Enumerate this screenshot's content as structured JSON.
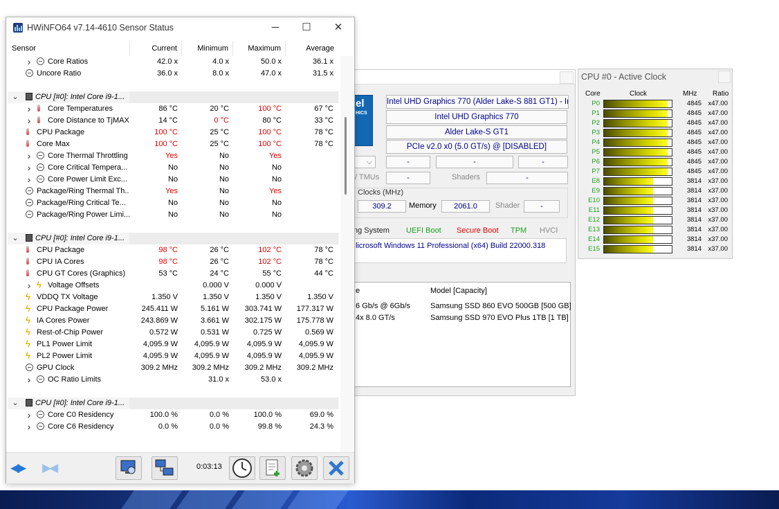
{
  "sensor_window": {
    "title": "HWiNFO64 v7.14-4610 Sensor Status",
    "columns": [
      "Sensor",
      "Current",
      "Minimum",
      "Maximum",
      "Average"
    ],
    "rows": [
      {
        "type": "item",
        "indent": 2,
        "chev": true,
        "icon": "ratio",
        "name": "Core Ratios",
        "cur": "42.0 x",
        "min": "4.0 x",
        "max": "50.0 x",
        "avg": "36.1 x"
      },
      {
        "type": "item",
        "indent": 1,
        "icon": "ratio",
        "name": "Uncore Ratio",
        "cur": "36.0 x",
        "min": "8.0 x",
        "max": "47.0 x",
        "avg": "31.5 x"
      },
      {
        "type": "blank"
      },
      {
        "type": "group",
        "name": "CPU [#0]: Intel Core i9-1..."
      },
      {
        "type": "item",
        "indent": 2,
        "chev": true,
        "icon": "temp",
        "name": "Core Temperatures",
        "cur": "86 °C",
        "min": "20 °C",
        "max": "100 °C",
        "avg": "67 °C",
        "red": [
          "max"
        ]
      },
      {
        "type": "item",
        "indent": 2,
        "chev": true,
        "icon": "temp",
        "name": "Core Distance to TjMAX",
        "cur": "14 °C",
        "min": "0 °C",
        "max": "80 °C",
        "avg": "33 °C",
        "red": [
          "min"
        ]
      },
      {
        "type": "item",
        "indent": 1,
        "icon": "temp",
        "name": "CPU Package",
        "cur": "100 °C",
        "min": "25 °C",
        "max": "100 °C",
        "avg": "78 °C",
        "red": [
          "cur",
          "max"
        ]
      },
      {
        "type": "item",
        "indent": 1,
        "icon": "temp",
        "name": "Core Max",
        "cur": "100 °C",
        "min": "25 °C",
        "max": "100 °C",
        "avg": "78 °C",
        "red": [
          "cur",
          "max"
        ]
      },
      {
        "type": "item",
        "indent": 2,
        "chev": true,
        "icon": "ratio",
        "name": "Core Thermal Throttling",
        "cur": "Yes",
        "min": "No",
        "max": "Yes",
        "avg": "",
        "red": [
          "cur",
          "max"
        ]
      },
      {
        "type": "item",
        "indent": 2,
        "chev": true,
        "icon": "ratio",
        "name": "Core Critical Tempera...",
        "cur": "No",
        "min": "No",
        "max": "No",
        "avg": ""
      },
      {
        "type": "item",
        "indent": 2,
        "chev": true,
        "icon": "ratio",
        "name": "Core Power Limit Exc...",
        "cur": "No",
        "min": "No",
        "max": "No",
        "avg": ""
      },
      {
        "type": "item",
        "indent": 1,
        "icon": "ratio",
        "name": "Package/Ring Thermal Th...",
        "cur": "Yes",
        "min": "No",
        "max": "Yes",
        "avg": "",
        "red": [
          "cur",
          "max"
        ]
      },
      {
        "type": "item",
        "indent": 1,
        "icon": "ratio",
        "name": "Package/Ring Critical Te...",
        "cur": "No",
        "min": "No",
        "max": "No",
        "avg": ""
      },
      {
        "type": "item",
        "indent": 1,
        "icon": "ratio",
        "name": "Package/Ring Power Limi...",
        "cur": "No",
        "min": "No",
        "max": "No",
        "avg": ""
      },
      {
        "type": "blank"
      },
      {
        "type": "group",
        "name": "CPU [#0]: Intel Core i9-1..."
      },
      {
        "type": "item",
        "indent": 1,
        "icon": "temp",
        "name": "CPU Package",
        "cur": "98 °C",
        "min": "26 °C",
        "max": "102 °C",
        "avg": "78 °C",
        "red": [
          "cur",
          "max"
        ]
      },
      {
        "type": "item",
        "indent": 1,
        "icon": "temp",
        "name": "CPU IA Cores",
        "cur": "98 °C",
        "min": "26 °C",
        "max": "102 °C",
        "avg": "78 °C",
        "red": [
          "cur",
          "max"
        ]
      },
      {
        "type": "item",
        "indent": 1,
        "icon": "temp",
        "name": "CPU GT Cores (Graphics)",
        "cur": "53 °C",
        "min": "24 °C",
        "max": "55 °C",
        "avg": "44 °C"
      },
      {
        "type": "item",
        "indent": 2,
        "chev": true,
        "icon": "volt",
        "name": "Voltage Offsets",
        "cur": "",
        "min": "0.000 V",
        "max": "0.000 V",
        "avg": ""
      },
      {
        "type": "item",
        "indent": 1,
        "icon": "volt",
        "name": "VDDQ TX Voltage",
        "cur": "1.350 V",
        "min": "1.350 V",
        "max": "1.350 V",
        "avg": "1.350 V"
      },
      {
        "type": "item",
        "indent": 1,
        "icon": "volt",
        "name": "CPU Package Power",
        "cur": "245.411 W",
        "min": "5.161 W",
        "max": "303.741 W",
        "avg": "177.317 W"
      },
      {
        "type": "item",
        "indent": 1,
        "icon": "volt",
        "name": "IA Cores Power",
        "cur": "243.869 W",
        "min": "3.661 W",
        "max": "302.175 W",
        "avg": "175.778 W"
      },
      {
        "type": "item",
        "indent": 1,
        "icon": "volt",
        "name": "Rest-of-Chip Power",
        "cur": "0.572 W",
        "min": "0.531 W",
        "max": "0.725 W",
        "avg": "0.569 W"
      },
      {
        "type": "item",
        "indent": 1,
        "icon": "volt",
        "name": "PL1 Power Limit",
        "cur": "4,095.9 W",
        "min": "4,095.9 W",
        "max": "4,095.9 W",
        "avg": "4,095.9 W"
      },
      {
        "type": "item",
        "indent": 1,
        "icon": "volt",
        "name": "PL2 Power Limit",
        "cur": "4,095.9 W",
        "min": "4,095.9 W",
        "max": "4,095.9 W",
        "avg": "4,095.9 W"
      },
      {
        "type": "item",
        "indent": 1,
        "icon": "ratio",
        "name": "GPU Clock",
        "cur": "309.2 MHz",
        "min": "309.2 MHz",
        "max": "309.2 MHz",
        "avg": "309.2 MHz"
      },
      {
        "type": "item",
        "indent": 2,
        "chev": true,
        "icon": "ratio",
        "name": "OC Ratio Limits",
        "cur": "",
        "min": "31.0 x",
        "max": "53.0 x",
        "avg": ""
      },
      {
        "type": "blank"
      },
      {
        "type": "group",
        "name": "CPU [#0]: Intel Core i9-1..."
      },
      {
        "type": "item",
        "indent": 2,
        "chev": true,
        "icon": "ratio",
        "name": "Core C0 Residency",
        "cur": "100.0 %",
        "min": "0.0 %",
        "max": "100.0 %",
        "avg": "69.0 %"
      },
      {
        "type": "item",
        "indent": 2,
        "chev": true,
        "icon": "ratio",
        "name": "Core C6 Residency",
        "cur": "0.0 %",
        "min": "0.0 %",
        "max": "99.8 %",
        "avg": "24.3 %"
      }
    ],
    "timer": "0:03:13"
  },
  "main_window": {
    "gpu_name": "Intel UHD Graphics 770 (Alder Lake-S 881 GT1) - Inte",
    "gpu_model": "Intel UHD Graphics 770",
    "gpu_codename": "Alder Lake-S GT1",
    "gpu_bus": "PCIe v2.0 x0 (5.0 GT/s) @ [DISABLED]",
    "dash": "-",
    "tmus_label": "/ TMUs",
    "shaders_label": "Shaders",
    "clocks_label": "Clocks (MHz)",
    "gpu_clock": "309.2",
    "memory_label": "Memory",
    "memory_clock": "2061.0",
    "shader_label": "Shader",
    "os_label": "ng System",
    "uefi": "UEFI Boot",
    "secure": "Secure Boot",
    "tpm": "TPM",
    "hvci": "HVCI",
    "os_value": "licrosoft Windows 11 Professional (x64) Build 22000.318",
    "drive_col1": "e",
    "drive_col2": "Model [Capacity]",
    "drives": [
      {
        "iface": "6 Gb/s @ 6Gb/s",
        "model": "Samsung SSD 860 EVO 500GB [500 GB]"
      },
      {
        "iface": "4x 8.0 GT/s",
        "model": "Samsung SSD 970 EVO Plus 1TB [1 TB]"
      }
    ],
    "logo_text": "el",
    "logo_sub": "HICS"
  },
  "clock_window": {
    "title": "CPU #0 - Active Clock",
    "headers": [
      "Core",
      "Clock",
      "MHz",
      "Ratio"
    ],
    "cores": [
      {
        "name": "P0",
        "mhz": "4845",
        "ratio": "x47.00",
        "fill": 0.94
      },
      {
        "name": "P1",
        "mhz": "4845",
        "ratio": "x47.00",
        "fill": 0.94
      },
      {
        "name": "P2",
        "mhz": "4845",
        "ratio": "x47.00",
        "fill": 0.94
      },
      {
        "name": "P3",
        "mhz": "4845",
        "ratio": "x47.00",
        "fill": 0.94
      },
      {
        "name": "P4",
        "mhz": "4845",
        "ratio": "x47.00",
        "fill": 0.94
      },
      {
        "name": "P5",
        "mhz": "4845",
        "ratio": "x47.00",
        "fill": 0.94
      },
      {
        "name": "P6",
        "mhz": "4845",
        "ratio": "x47.00",
        "fill": 0.94
      },
      {
        "name": "P7",
        "mhz": "4845",
        "ratio": "x47.00",
        "fill": 0.94
      },
      {
        "name": "E8",
        "mhz": "3814",
        "ratio": "x37.00",
        "fill": 0.72
      },
      {
        "name": "E9",
        "mhz": "3814",
        "ratio": "x37.00",
        "fill": 0.72
      },
      {
        "name": "E10",
        "mhz": "3814",
        "ratio": "x37.00",
        "fill": 0.72
      },
      {
        "name": "E11",
        "mhz": "3814",
        "ratio": "x37.00",
        "fill": 0.72
      },
      {
        "name": "E12",
        "mhz": "3814",
        "ratio": "x37.00",
        "fill": 0.72
      },
      {
        "name": "E13",
        "mhz": "3814",
        "ratio": "x37.00",
        "fill": 0.72
      },
      {
        "name": "E14",
        "mhz": "3814",
        "ratio": "x37.00",
        "fill": 0.72
      },
      {
        "name": "E15",
        "mhz": "3814",
        "ratio": "x37.00",
        "fill": 0.72
      }
    ]
  },
  "colors": {
    "alert_red": "#e00000",
    "core_green": "#1aa01a",
    "link_blue": "#00008b"
  }
}
